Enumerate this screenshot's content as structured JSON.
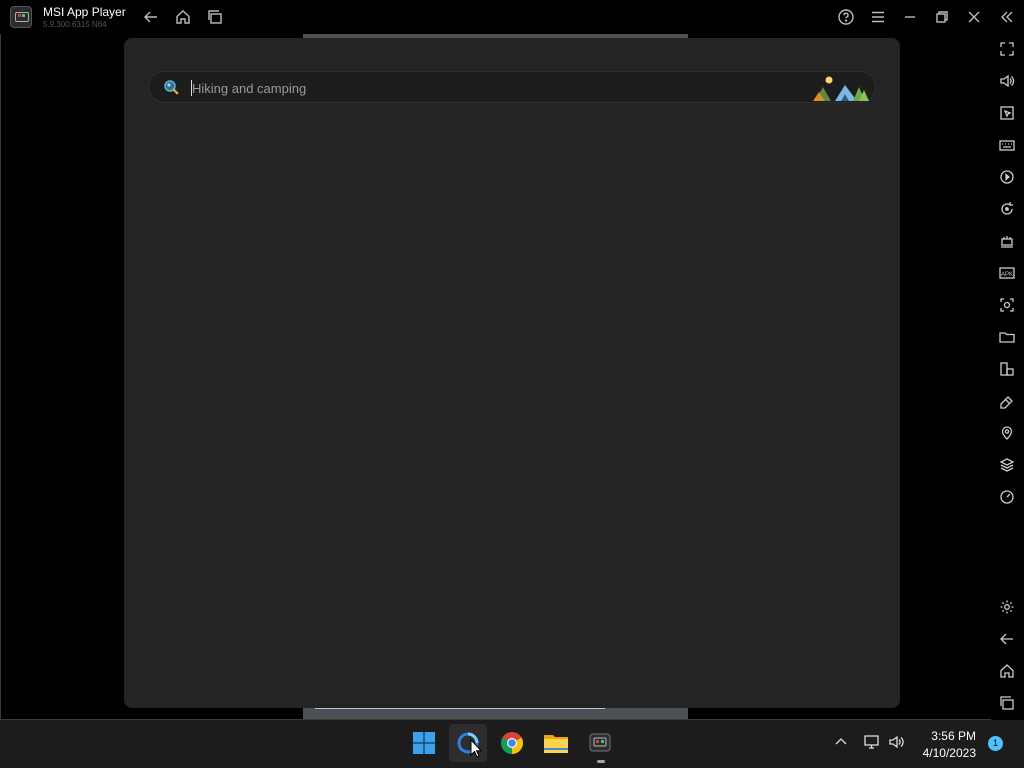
{
  "window": {
    "app_name": "MSI App Player",
    "version": "5.9.300.6315  N64"
  },
  "search": {
    "placeholder": "Hiking and camping",
    "value": ""
  },
  "sidebar": {
    "items": [
      "fullscreen-icon",
      "volume-icon",
      "macro-icon",
      "keyboard-icon",
      "record-icon",
      "rotate-icon",
      "multi-instance-icon",
      "apk-icon",
      "screenshot-icon",
      "folder-icon",
      "resize-icon",
      "eraser-icon",
      "location-icon",
      "layers-icon",
      "speed-icon",
      "settings-icon",
      "back-icon",
      "home-icon",
      "recents-icon"
    ]
  },
  "taskbar": {
    "time": "3:56 PM",
    "date": "4/10/2023",
    "notification_count": "1"
  },
  "colors": {
    "panel_bg": "#242424",
    "accent": "#4cc2ff"
  }
}
